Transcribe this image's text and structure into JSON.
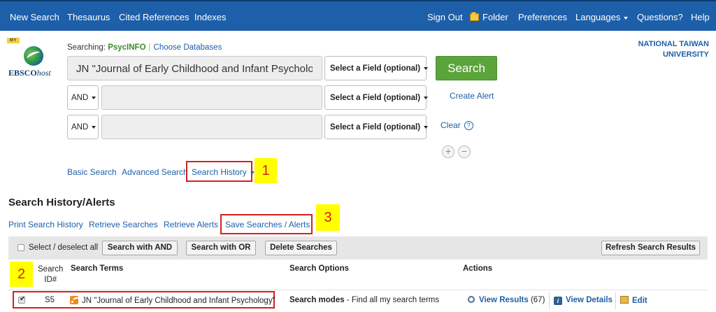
{
  "topnav": {
    "new_search": "New Search",
    "thesaurus": "Thesaurus",
    "cited_references": "Cited References",
    "indexes": "Indexes",
    "sign_out": "Sign Out",
    "folder": "Folder",
    "preferences": "Preferences",
    "languages": "Languages",
    "questions": "Questions?",
    "help": "Help"
  },
  "logo": {
    "badge": "MY",
    "brand_bold": "EBSCO",
    "brand_italic": "host"
  },
  "institution": {
    "line1": "NATIONAL TAIWAN",
    "line2": "UNIVERSITY"
  },
  "search": {
    "searching_label": "Searching:",
    "database": "PsycINFO",
    "choose_databases": "Choose Databases",
    "row1_value": "JN \"Journal of Early Childhood and Infant Psycholo",
    "field_select": "Select a Field (optional)",
    "bool_op": "AND",
    "search_button": "Search",
    "create_alert": "Create Alert",
    "clear": "Clear",
    "help_glyph": "?",
    "add_row": "+",
    "remove_row": "−"
  },
  "subnav": {
    "basic_search": "Basic Search",
    "advanced_search": "Advanced Search",
    "search_history": "Search History"
  },
  "annotations": {
    "n1": "1",
    "n2": "2",
    "n3": "3"
  },
  "history": {
    "title": "Search History/Alerts",
    "print": "Print Search History",
    "retrieve_searches": "Retrieve Searches",
    "retrieve_alerts": "Retrieve Alerts",
    "save": "Save Searches / Alerts",
    "select_all": "Select / deselect all",
    "search_and": "Search with AND",
    "search_or": "Search with OR",
    "delete": "Delete Searches",
    "refresh": "Refresh Search Results",
    "columns": {
      "search_id_line1": "Search",
      "search_id_line2": "ID#",
      "terms": "Search Terms",
      "options": "Search Options",
      "actions": "Actions"
    },
    "row": {
      "checked": true,
      "id": "S5",
      "terms": "JN \"Journal of Early Childhood and Infant Psychology\"",
      "mode_label": "Search modes",
      "mode_value": " - Find all my search terms",
      "view_results": "View Results",
      "count": "(67)",
      "view_details": "View Details",
      "edit": "Edit"
    }
  },
  "colors": {
    "nav_blue": "#1d5fa8",
    "search_green": "#5ba43a",
    "highlight_red": "#d42020",
    "badge_yellow": "#ffff00"
  }
}
